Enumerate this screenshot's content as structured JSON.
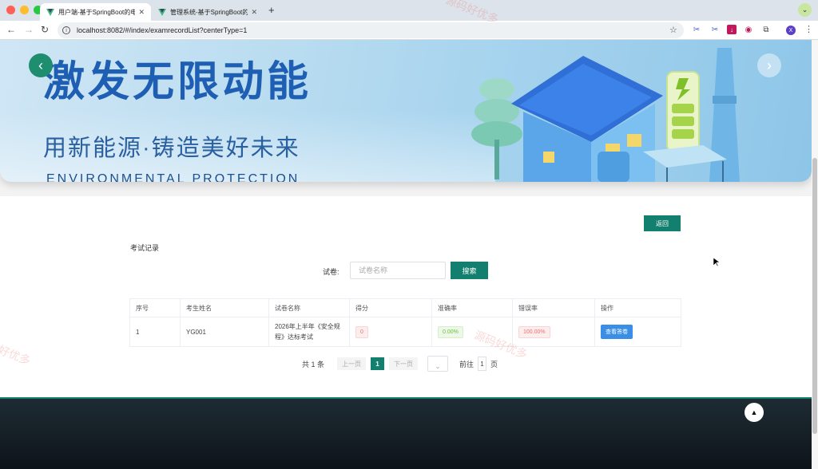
{
  "browser": {
    "tabs": [
      {
        "title": "用户端-基于SpringBoot的电力",
        "active": true
      },
      {
        "title": "管理系统-基于SpringBoot的电",
        "active": false
      }
    ],
    "new_tab": "+",
    "url": "localhost:8082/#/index/examrecordList?centerType=1",
    "avatar_letter": "X"
  },
  "banner": {
    "title": "激发无限动能",
    "subtitle": "用新能源·铸造美好未来",
    "english": "ENVIRONMENTAL PROTECTION"
  },
  "page": {
    "back_label": "返回",
    "section_title": "考试记录",
    "search": {
      "label": "试卷:",
      "placeholder": "试卷名称",
      "button": "搜索"
    },
    "table": {
      "headers": [
        "序号",
        "考生姓名",
        "试卷名称",
        "得分",
        "准确率",
        "错误率",
        "操作"
      ],
      "rows": [
        {
          "index": "1",
          "student": "YG001",
          "paper": "2026年上半年《安全规程》达标考试",
          "score": "0",
          "accuracy": "0.00%",
          "error_rate": "100.00%",
          "action": "查看答卷"
        }
      ]
    },
    "pagination": {
      "total": "共 1 条",
      "prev": "上一页",
      "current": "1",
      "next": "下一页",
      "goto_prefix": "前往",
      "goto_value": "1",
      "goto_suffix": "页"
    }
  },
  "watermark": "源码好优多",
  "colors": {
    "primary": "#13806f",
    "view_button": "#3a8ee6",
    "footer": "#141d23"
  }
}
